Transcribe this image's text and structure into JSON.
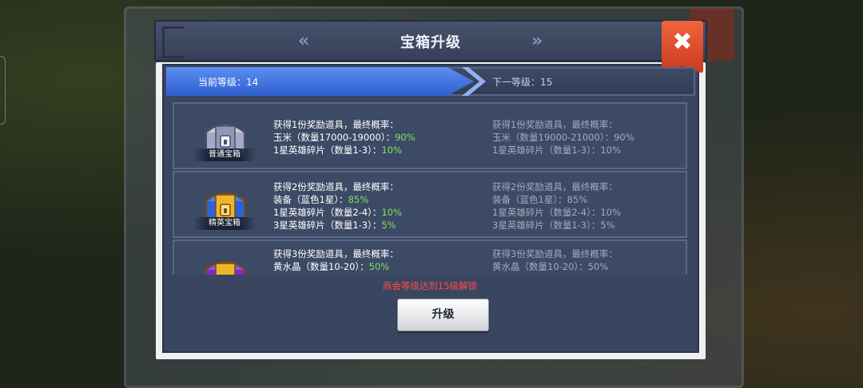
{
  "dialog": {
    "title": "宝箱升级",
    "close_label": "✖"
  },
  "level": {
    "current": "当前等级：14",
    "next": "下一等级：15"
  },
  "chests": [
    {
      "name": "普通宝箱",
      "color": "#8f97b4",
      "current": {
        "heading": "获得1份奖励道具，最终概率：",
        "items": [
          {
            "text": "玉米（数量17000-19000）：",
            "pct": "90%"
          },
          {
            "text": "1星英雄碎片（数量1-3）：",
            "pct": "10%"
          }
        ]
      },
      "next": {
        "heading": "获得1份奖励道具，最终概率：",
        "items": [
          {
            "text": "玉米（数量19000-21000）：",
            "pct": "90%"
          },
          {
            "text": "1星英雄碎片（数量1-3）：",
            "pct": "10%"
          }
        ]
      }
    },
    {
      "name": "精英宝箱",
      "color": "#3a6ee0",
      "current": {
        "heading": "获得2份奖励道具，最终概率：",
        "items": [
          {
            "text": "装备（蓝色1星）：",
            "pct": "85%"
          },
          {
            "text": "1星英雄碎片（数量2-4）：",
            "pct": "10%"
          },
          {
            "text": "3星英雄碎片（数量1-3）：",
            "pct": "5%"
          }
        ]
      },
      "next": {
        "heading": "获得2份奖励道具，最终概率：",
        "items": [
          {
            "text": "装备（蓝色1星）：",
            "pct": "85%"
          },
          {
            "text": "1星英雄碎片（数量2-4）：",
            "pct": "10%"
          },
          {
            "text": "3星英雄碎片（数量1-3）：",
            "pct": "5%"
          }
        ]
      }
    },
    {
      "name": "",
      "color": "#8a3ad0",
      "current": {
        "heading": "获得3份奖励道具，最终概率：",
        "items": [
          {
            "text": "黄水晶（数量10-20）：",
            "pct": "50%"
          }
        ]
      },
      "next": {
        "heading": "获得3份奖励道具，最终概率：",
        "items": [
          {
            "text": "黄水晶（数量10-20）：",
            "pct": "50%"
          }
        ]
      }
    }
  ],
  "unlock_notice": "商会等级达到15级解锁",
  "upgrade_button": "升级",
  "colors": {
    "percent_green": "#7ce45a",
    "warning_red": "#ff4a4a",
    "close_red": "#e0502e",
    "level_blue": "#4a7ee8"
  }
}
